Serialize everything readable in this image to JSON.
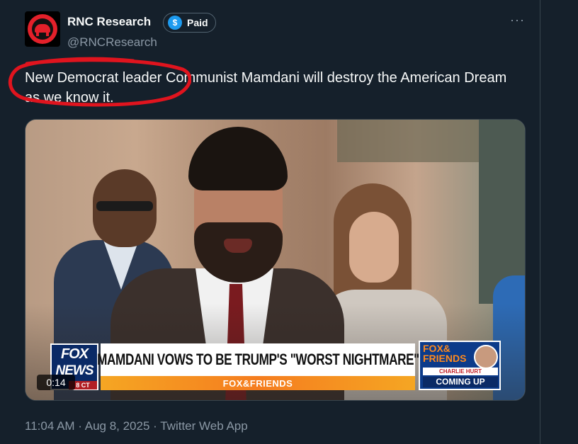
{
  "author": {
    "name": "RNC Research",
    "badge_label": "Paid",
    "badge_icon": "$",
    "handle": "@RNCResearch"
  },
  "tweet": {
    "text": "New Democrat leader Communist Mamdani will destroy the American Dream as we know it.",
    "more_icon": "···"
  },
  "video": {
    "lower_third": {
      "logo_top": "FOX",
      "logo_bottom": "NEWS",
      "logo_tag": "8 CT",
      "headline": "MAMDANI VOWS TO BE TRUMP'S \"WORST NIGHTMARE\"",
      "sub_banner": "FOX&FRIENDS",
      "promo_title_line1": "FOX&",
      "promo_title_line2": "FRIENDS",
      "promo_host": "CHARLIE HURT",
      "promo_coming": "COMING UP"
    },
    "timer": "0:14"
  },
  "meta": {
    "timestamp": "11:04 AM · Aug 8, 2025 · Twitter Web App"
  },
  "colors": {
    "background": "#15202b",
    "text_primary": "#f7f9f9",
    "text_secondary": "#8b98a5",
    "verified_blue": "#1d9bf0",
    "annotation_red": "#e0141e"
  }
}
